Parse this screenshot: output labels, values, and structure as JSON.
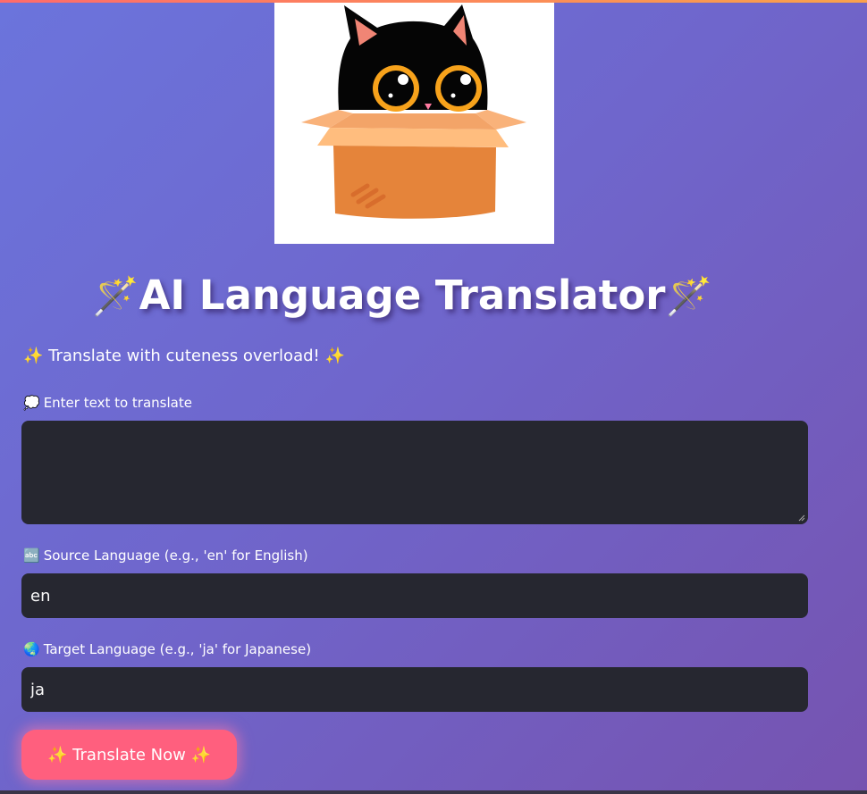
{
  "header": {
    "image_alt": "black cat in a box",
    "title": "AI Language Translator",
    "title_icon": "magic-wand",
    "subtitle_icon": "sparkles",
    "subtitle": "Translate with cuteness overload!"
  },
  "form": {
    "text_field": {
      "icon": "speech-bubble",
      "label": "Enter text to translate",
      "value": "",
      "placeholder": ""
    },
    "source_language": {
      "icon": "abc-input",
      "label": "Source Language (e.g., 'en' for English)",
      "value": "en"
    },
    "target_language": {
      "icon": "globe",
      "label": "Target Language (e.g., 'ja' for Japanese)",
      "value": "ja"
    },
    "submit": {
      "icon": "sparkles",
      "label": "Translate Now"
    }
  },
  "colors": {
    "background_start": "#6b74dc",
    "background_end": "#7653b0",
    "input_background": "#262730",
    "button": "#ff5f7e",
    "accent_bar": "#ff6b6b"
  }
}
